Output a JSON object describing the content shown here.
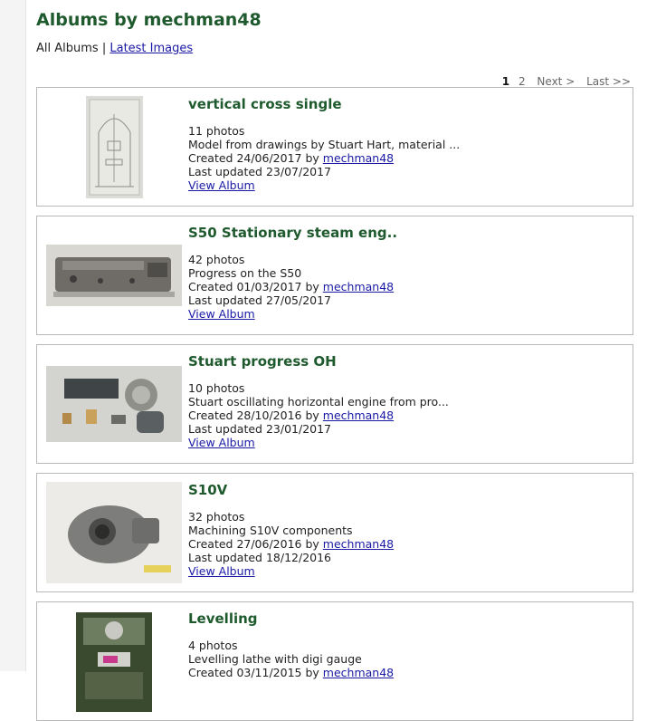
{
  "page": {
    "title": "Albums by mechman48",
    "nav_all": "All Albums",
    "nav_separator": "|",
    "nav_latest": "Latest Images"
  },
  "pager": {
    "page1": "1",
    "page2": "2",
    "next": "Next >",
    "last": "Last >>"
  },
  "albums": [
    {
      "title": "vertical cross single",
      "photos": "11 photos",
      "description": "Model from drawings by Stuart Hart, material ...",
      "created_prefix": "Created 24/06/2017 by",
      "author": "mechman48",
      "updated": "Last updated 23/07/2017",
      "view": "View Album"
    },
    {
      "title": "S50 Stationary steam eng..",
      "photos": "42 photos",
      "description": "Progress on the S50",
      "created_prefix": "Created 01/03/2017 by",
      "author": "mechman48",
      "updated": "Last updated 27/05/2017",
      "view": "View Album"
    },
    {
      "title": "Stuart progress OH",
      "photos": "10 photos",
      "description": "Stuart oscillating horizontal engine from pro...",
      "created_prefix": "Created 28/10/2016 by",
      "author": "mechman48",
      "updated": "Last updated 23/01/2017",
      "view": "View Album"
    },
    {
      "title": "S10V",
      "photos": "32 photos",
      "description": "Machining S10V components",
      "created_prefix": "Created 27/06/2016 by",
      "author": "mechman48",
      "updated": "Last updated 18/12/2016",
      "view": "View Album"
    },
    {
      "title": "Levelling",
      "photos": "4 photos",
      "description": "Levelling lathe with digi gauge",
      "created_prefix": "Created 03/11/2015 by",
      "author": "mechman48",
      "updated": "",
      "view": ""
    }
  ]
}
